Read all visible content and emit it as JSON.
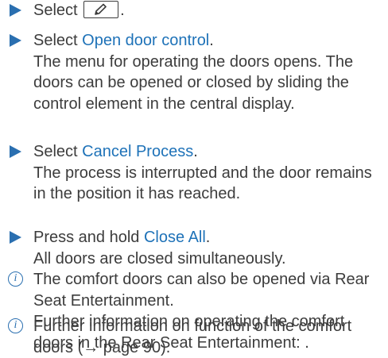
{
  "steps": [
    {
      "action": "Select",
      "after": "."
    },
    {
      "action": "Select",
      "link": "Open door control",
      "after": ".",
      "result": "The menu for operating the doors opens. The doors can be opened or closed by sliding the control element in the central display."
    },
    {
      "action": "Select",
      "link": "Cancel Process",
      "after": ".",
      "result": "The process is interrupted and the door remains in the position it has reached."
    },
    {
      "action": "Press and hold",
      "link": "Close All",
      "after": ".",
      "result": "All doors are closed simultaneously."
    }
  ],
  "notes": [
    {
      "icon": "info-icon",
      "line1": "The comfort doors can also be opened via Rear Seat Entertainment.",
      "line2": "Further information on operating the comfort doors in the Rear Seat Entertainment: ."
    },
    {
      "icon": "info-icon",
      "text": "Further information on function of the comfort doors (→ page 90)."
    }
  ],
  "icons": {
    "edit": "pencil-icon"
  },
  "colors": {
    "link": "#1e72b8",
    "marker": "#2a6fb0",
    "text": "#3c3c3c"
  }
}
